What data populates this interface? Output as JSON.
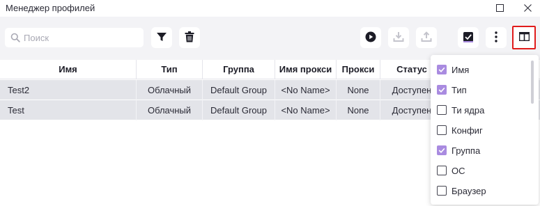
{
  "window": {
    "title": "Менеджер профилей",
    "controls": {
      "maximize_icon": "square-icon",
      "close_icon": "close-icon"
    }
  },
  "toolbar": {
    "search_placeholder": "Поиск",
    "search_value": "",
    "buttons": [
      "filter-icon",
      "trash-icon",
      "play-icon",
      "download-icon",
      "upload-icon",
      "checkbox-icon",
      "more-vertical-icon",
      "columns-icon"
    ]
  },
  "table": {
    "headers": [
      "Имя",
      "Тип",
      "Группа",
      "Имя прокси",
      "Прокси",
      "Статус"
    ],
    "rows": [
      [
        "Test2",
        "Облачный",
        "Default Group",
        "<No Name>",
        "None",
        "Доступен"
      ],
      [
        "Test",
        "Облачный",
        "Default Group",
        "<No Name>",
        "None",
        "Доступен"
      ]
    ]
  },
  "column_menu": {
    "items": [
      {
        "label": "Имя",
        "checked": true
      },
      {
        "label": "Тип",
        "checked": true
      },
      {
        "label": "Ти ядра",
        "checked": false
      },
      {
        "label": "Конфиг",
        "checked": false
      },
      {
        "label": "Группа",
        "checked": true
      },
      {
        "label": "ОС",
        "checked": false
      },
      {
        "label": "Браузер",
        "checked": false
      }
    ]
  },
  "colors": {
    "accent_check": "#a98be0",
    "highlight_border": "#e01b1b",
    "row_background": "#e3e4e9",
    "toolbar_background": "#f3f3f6"
  }
}
